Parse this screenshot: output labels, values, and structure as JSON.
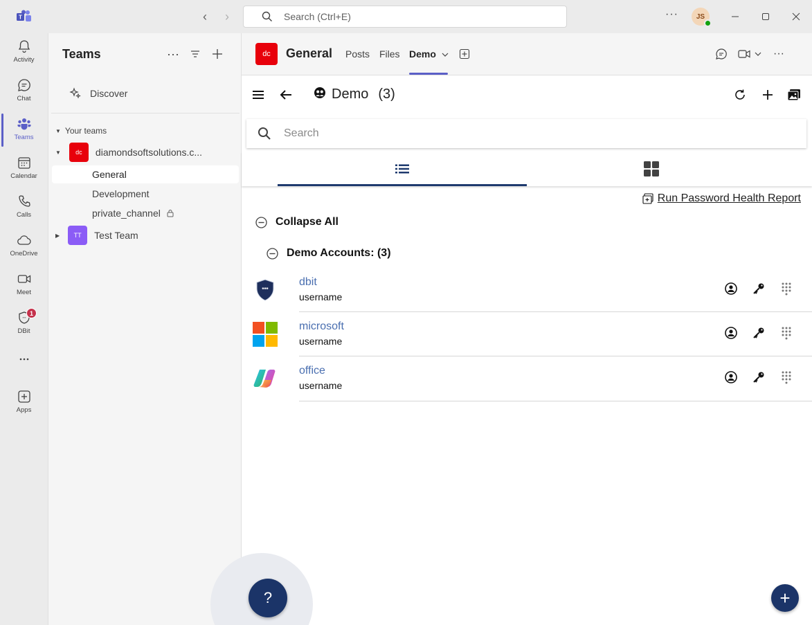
{
  "titlebar": {
    "search_placeholder": "Search (Ctrl+E)",
    "avatar_initials": "JS"
  },
  "rail": {
    "items": [
      {
        "label": "Activity",
        "icon": "bell-icon"
      },
      {
        "label": "Chat",
        "icon": "chat-icon"
      },
      {
        "label": "Teams",
        "icon": "teams-icon",
        "active": true
      },
      {
        "label": "Calendar",
        "icon": "calendar-icon"
      },
      {
        "label": "Calls",
        "icon": "phone-icon"
      },
      {
        "label": "OneDrive",
        "icon": "cloud-icon"
      },
      {
        "label": "Meet",
        "icon": "video-icon"
      },
      {
        "label": "DBit",
        "icon": "shield-icon",
        "badge": "1"
      },
      {
        "label": "",
        "icon": "more-icon"
      },
      {
        "label": "Apps",
        "icon": "add-app-icon"
      }
    ]
  },
  "teams_panel": {
    "title": "Teams",
    "discover": "Discover",
    "your_teams": "Your teams",
    "teams": [
      {
        "initials": "dc",
        "name": "diamondsoftsolutions.c...",
        "color": "#e8000b",
        "channels": [
          {
            "name": "General",
            "selected": true
          },
          {
            "name": "Development"
          },
          {
            "name": "private_channel",
            "locked": true
          }
        ]
      },
      {
        "initials": "TT",
        "name": "Test Team",
        "color": "#8b5cf6"
      }
    ]
  },
  "channel_header": {
    "initials": "dc",
    "name": "General",
    "tabs": [
      "Posts",
      "Files",
      "Demo"
    ],
    "active_tab": "Demo"
  },
  "app": {
    "title": "Demo",
    "count": "(3)",
    "search_placeholder": "Search",
    "report_link": "Run Password Health Report",
    "collapse_all": "Collapse All",
    "group_title": "Demo Accounts: (3)",
    "accounts": [
      {
        "name": "dbit",
        "username": "username",
        "logo": "dbit-shield-icon"
      },
      {
        "name": "microsoft",
        "username": "username",
        "logo": "microsoft-logo-icon"
      },
      {
        "name": "office",
        "username": "username",
        "logo": "copilot-logo-icon"
      }
    ],
    "help_label": "?",
    "fab_label": "+"
  },
  "colors": {
    "accent": "#5b5fc7",
    "app_primary": "#1b3468",
    "link": "#4a6fb0"
  }
}
